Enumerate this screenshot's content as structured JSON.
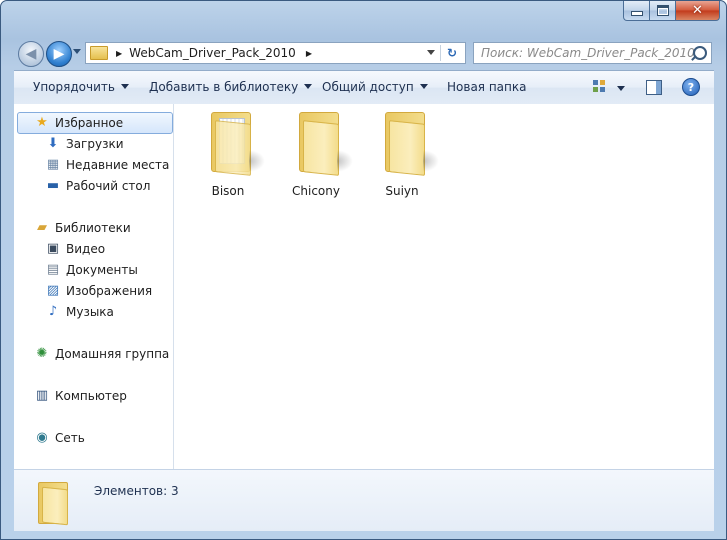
{
  "window": {
    "close_glyph": "✕"
  },
  "nav": {
    "back_glyph": "◀",
    "forward_glyph": "▶"
  },
  "address": {
    "path": "WebCam_Driver_Pack_2010",
    "separator": "▶",
    "refresh_glyph": "↻"
  },
  "search": {
    "placeholder": "Поиск: WebCam_Driver_Pack_2010"
  },
  "toolbar": {
    "organize": "Упорядочить",
    "add_to_library": "Добавить в библиотеку",
    "share": "Общий доступ",
    "new_folder": "Новая папка",
    "help_glyph": "?"
  },
  "sidebar": {
    "favorites": {
      "label": "Избранное",
      "icon": "star-icon"
    },
    "downloads": {
      "label": "Загрузки",
      "icon": "download-icon"
    },
    "recent": {
      "label": "Недавние места",
      "icon": "recent-places-icon"
    },
    "desktop": {
      "label": "Рабочий стол",
      "icon": "desktop-icon"
    },
    "libraries": {
      "label": "Библиотеки",
      "icon": "library-icon"
    },
    "video": {
      "label": "Видео",
      "icon": "video-icon"
    },
    "documents": {
      "label": "Документы",
      "icon": "documents-icon"
    },
    "pictures": {
      "label": "Изображения",
      "icon": "pictures-icon"
    },
    "music": {
      "label": "Музыка",
      "icon": "music-icon"
    },
    "homegroup": {
      "label": "Домашняя группа",
      "icon": "homegroup-icon"
    },
    "computer": {
      "label": "Компьютер",
      "icon": "computer-icon"
    },
    "network": {
      "label": "Сеть",
      "icon": "network-icon"
    }
  },
  "files": [
    {
      "name": "Bison"
    },
    {
      "name": "Chicony"
    },
    {
      "name": "Suiyn"
    }
  ],
  "status": {
    "count_text": "Элементов: 3"
  },
  "colors": {
    "accent": "#2f7fcf",
    "selection": "#d5e6fb",
    "folder": "#f3dd8c"
  }
}
